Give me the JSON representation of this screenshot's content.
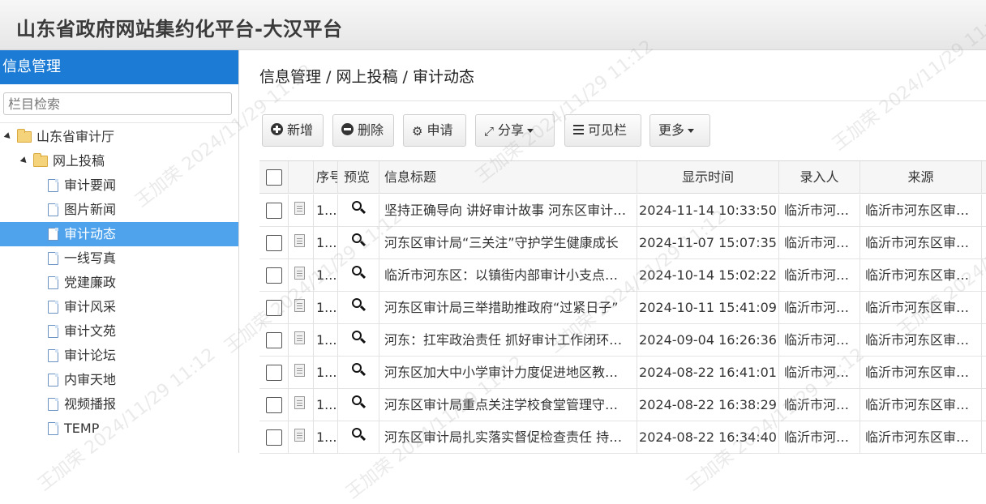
{
  "header": {
    "title": "山东省政府网站集约化平台-大汉平台"
  },
  "sidebar": {
    "title": "信息管理",
    "search_placeholder": "栏目检索",
    "tree": [
      {
        "label": "山东省审计厅",
        "level": 0,
        "type": "folder",
        "expanded": true
      },
      {
        "label": "网上投稿",
        "level": 1,
        "type": "folder",
        "expanded": true
      },
      {
        "label": "审计要闻",
        "level": 2,
        "type": "doc"
      },
      {
        "label": "图片新闻",
        "level": 2,
        "type": "doc"
      },
      {
        "label": "审计动态",
        "level": 2,
        "type": "doc",
        "selected": true
      },
      {
        "label": "一线写真",
        "level": 2,
        "type": "doc"
      },
      {
        "label": "党建廉政",
        "level": 2,
        "type": "doc"
      },
      {
        "label": "审计风采",
        "level": 2,
        "type": "doc"
      },
      {
        "label": "审计文苑",
        "level": 2,
        "type": "doc"
      },
      {
        "label": "审计论坛",
        "level": 2,
        "type": "doc"
      },
      {
        "label": "内审天地",
        "level": 2,
        "type": "doc"
      },
      {
        "label": "视频播报",
        "level": 2,
        "type": "doc"
      },
      {
        "label": "TEMP",
        "level": 2,
        "type": "doc"
      }
    ]
  },
  "main": {
    "breadcrumb": "信息管理 / 网上投稿 / 审计动态",
    "toolbar": {
      "add": "新增",
      "delete": "删除",
      "apply": "申请",
      "share": "分享",
      "columns": "可见栏",
      "more": "更多"
    },
    "table": {
      "headers": {
        "seq": "序号",
        "preview": "预览",
        "title": "信息标题",
        "time": "显示时间",
        "author": "录入人",
        "source": "来源"
      },
      "rows": [
        {
          "seq": "1...",
          "title": "坚持正确导向 讲好审计故事 河东区审计…",
          "time": "2024-11-14 10:33:50",
          "author": "临沂市河…",
          "source": "临沂市河东区审…"
        },
        {
          "seq": "1...",
          "title": "河东区审计局“三关注”守护学生健康成长",
          "time": "2024-11-07 15:07:35",
          "author": "临沂市河…",
          "source": "临沂市河东区审…"
        },
        {
          "seq": "1...",
          "title": "临沂市河东区：以镇街内部审计小支点…",
          "time": "2024-10-14 15:02:22",
          "author": "临沂市河…",
          "source": "临沂市河东区审…"
        },
        {
          "seq": "1...",
          "title": "河东区审计局三举措助推政府“过紧日子”",
          "time": "2024-10-11 15:41:09",
          "author": "临沂市河…",
          "source": "临沂市河东区审…"
        },
        {
          "seq": "1...",
          "title": "河东：扛牢政治责任 抓好审计工作闭环…",
          "time": "2024-09-04 16:26:36",
          "author": "临沂市河…",
          "source": "临沂市河东区审…"
        },
        {
          "seq": "1...",
          "title": "河东区加大中小学审计力度促进地区教…",
          "time": "2024-08-22 16:41:01",
          "author": "临沂市河…",
          "source": "临沂市河东区审…"
        },
        {
          "seq": "1...",
          "title": "河东区审计局重点关注学校食堂管理守…",
          "time": "2024-08-22 16:38:29",
          "author": "临沂市河…",
          "source": "临沂市河东区审…"
        },
        {
          "seq": "1...",
          "title": "河东区审计局扎实落实督促检查责任 持…",
          "time": "2024-08-22 16:34:40",
          "author": "临沂市河…",
          "source": "临沂市河东区审…"
        }
      ]
    }
  },
  "watermark": {
    "text": "王加荣 2024/11/29 11:12"
  }
}
